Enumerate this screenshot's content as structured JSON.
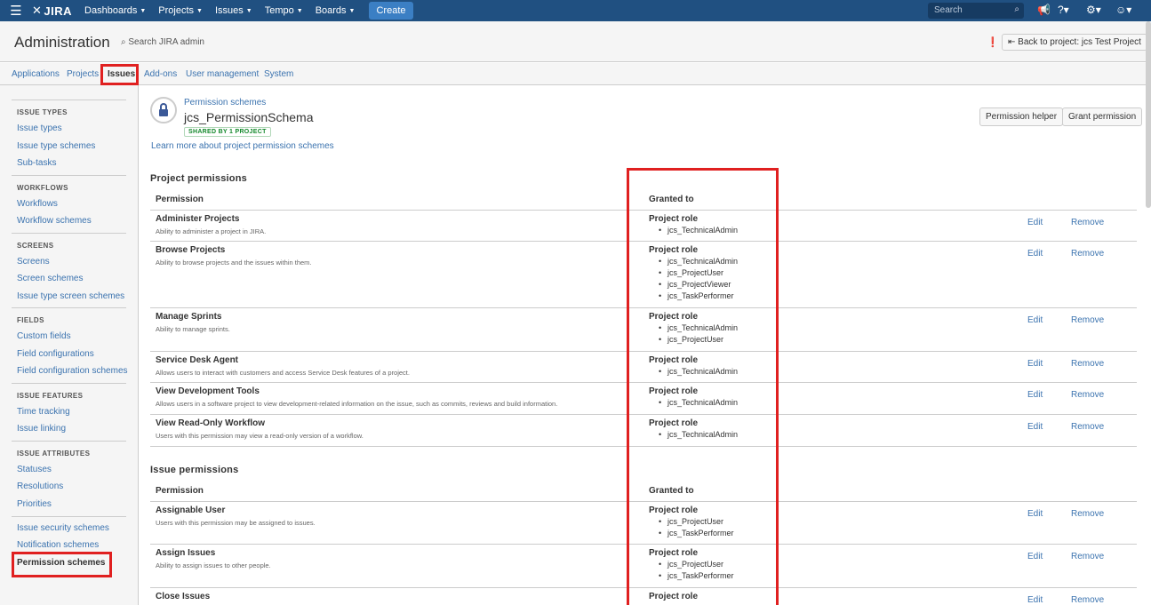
{
  "topnav": {
    "logo": "JIRA",
    "items": [
      "Dashboards",
      "Projects",
      "Issues",
      "Tempo",
      "Boards"
    ],
    "create": "Create",
    "search_placeholder": "Search"
  },
  "admin": {
    "title": "Administration",
    "search": "Search JIRA admin",
    "back_button": "Back to project: jcs Test Project"
  },
  "tabs": [
    "Applications",
    "Projects",
    "Issues",
    "Add-ons",
    "User management",
    "System"
  ],
  "sidebar": {
    "sections": [
      {
        "header": "ISSUE TYPES",
        "links": [
          "Issue types",
          "Issue type schemes",
          "Sub-tasks"
        ]
      },
      {
        "header": "WORKFLOWS",
        "links": [
          "Workflows",
          "Workflow schemes"
        ]
      },
      {
        "header": "SCREENS",
        "links": [
          "Screens",
          "Screen schemes",
          "Issue type screen schemes"
        ]
      },
      {
        "header": "FIELDS",
        "links": [
          "Custom fields",
          "Field configurations",
          "Field configuration schemes"
        ]
      },
      {
        "header": "ISSUE FEATURES",
        "links": [
          "Time tracking",
          "Issue linking"
        ]
      },
      {
        "header": "ISSUE ATTRIBUTES",
        "links": [
          "Statuses",
          "Resolutions",
          "Priorities"
        ]
      },
      {
        "header": "",
        "links": [
          "Issue security schemes",
          "Notification schemes",
          "Permission schemes"
        ]
      }
    ]
  },
  "scheme": {
    "breadcrumb": "Permission schemes",
    "name": "jcs_PermissionSchema",
    "badge": "SHARED BY 1 PROJECT",
    "learn_more": "Learn more about project permission schemes",
    "helper_button": "Permission helper",
    "grant_button": "Grant permission"
  },
  "columns": {
    "permission": "Permission",
    "granted": "Granted to"
  },
  "actions": {
    "edit": "Edit",
    "remove": "Remove"
  },
  "project_permissions": {
    "title": "Project permissions",
    "rows": [
      {
        "name": "Administer Projects",
        "desc": "Ability to administer a project in JIRA.",
        "grant_type": "Project role",
        "grantees": [
          "jcs_TechnicalAdmin"
        ]
      },
      {
        "name": "Browse Projects",
        "desc": "Ability to browse projects and the issues within them.",
        "grant_type": "Project role",
        "grantees": [
          "jcs_TechnicalAdmin",
          "jcs_ProjectUser",
          "jcs_ProjectViewer",
          "jcs_TaskPerformer"
        ]
      },
      {
        "name": "Manage Sprints",
        "desc": "Ability to manage sprints.",
        "grant_type": "Project role",
        "grantees": [
          "jcs_TechnicalAdmin",
          "jcs_ProjectUser"
        ]
      },
      {
        "name": "Service Desk Agent",
        "desc": "Allows users to interact with customers and access Service Desk features of a project.",
        "grant_type": "Project role",
        "grantees": [
          "jcs_TechnicalAdmin"
        ]
      },
      {
        "name": "View Development Tools",
        "desc": "Allows users in a software project to view development-related information on the issue, such as commits, reviews and build information.",
        "grant_type": "Project role",
        "grantees": [
          "jcs_TechnicalAdmin"
        ]
      },
      {
        "name": "View Read-Only Workflow",
        "desc": "Users with this permission may view a read-only version of a workflow.",
        "grant_type": "Project role",
        "grantees": [
          "jcs_TechnicalAdmin"
        ]
      }
    ]
  },
  "issue_permissions": {
    "title": "Issue permissions",
    "rows": [
      {
        "name": "Assignable User",
        "desc": "Users with this permission may be assigned to issues.",
        "grant_type": "Project role",
        "grantees": [
          "jcs_ProjectUser",
          "jcs_TaskPerformer"
        ]
      },
      {
        "name": "Assign Issues",
        "desc": "Ability to assign issues to other people.",
        "grant_type": "Project role",
        "grantees": [
          "jcs_ProjectUser",
          "jcs_TaskPerformer"
        ]
      },
      {
        "name": "Close Issues",
        "desc": "",
        "grant_type": "Project role",
        "grantees": []
      }
    ]
  }
}
